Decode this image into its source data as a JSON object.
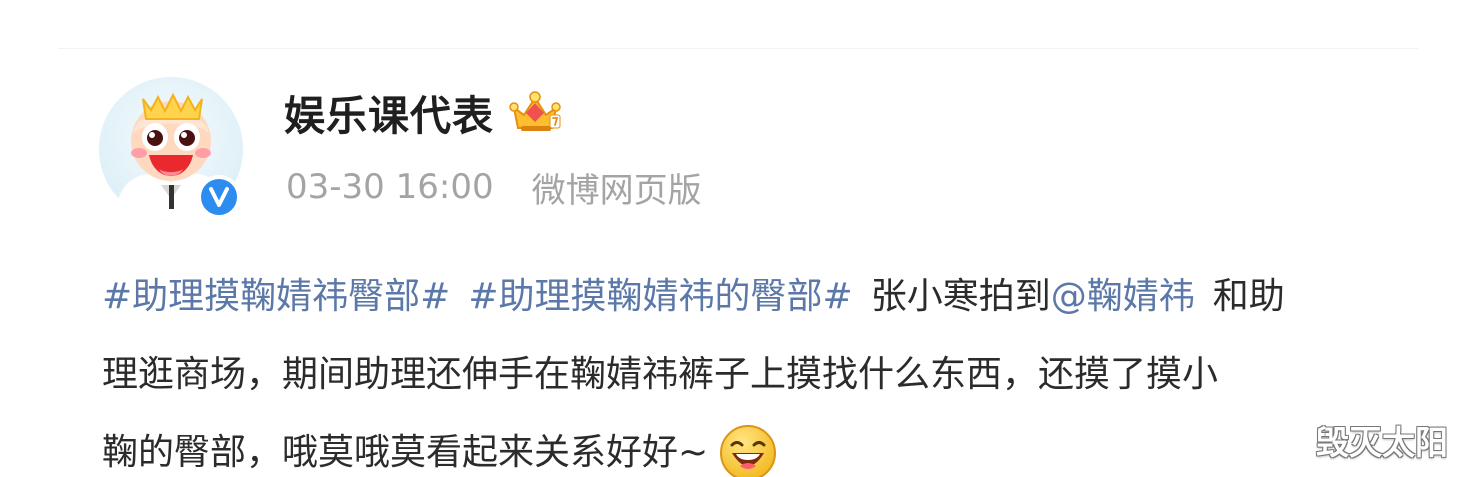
{
  "colors": {
    "link": "#5b78a8",
    "text": "#2b2b2b",
    "meta": "#a4a4a4",
    "username": "#1f1f1f",
    "verified_badge": "#2d8cf0"
  },
  "post": {
    "author": {
      "name": "娱乐课代表",
      "avatar_icon": "cartoon-avatar",
      "verified_icon": "verified-v-icon",
      "vip_icon": "crown-icon"
    },
    "meta": {
      "time": "03-30 16:00",
      "source": "微博网页版"
    },
    "content": {
      "line1": {
        "tag1": "#助理摸鞠婧祎臀部#",
        "tag2": "#助理摸鞠婧祎的臀部#",
        "text1": "张小寒拍到",
        "mention": "@鞠婧祎",
        "text2": "和助"
      },
      "line2": "理逛商场，期间助理还伸手在鞠婧祎裤子上摸找什么东西，还摸了摸小",
      "line3": "鞠的臀部，哦莫哦莫看起来关系好好~",
      "emoji": "laughing-emoji"
    }
  },
  "watermark": "毁灭太阳"
}
